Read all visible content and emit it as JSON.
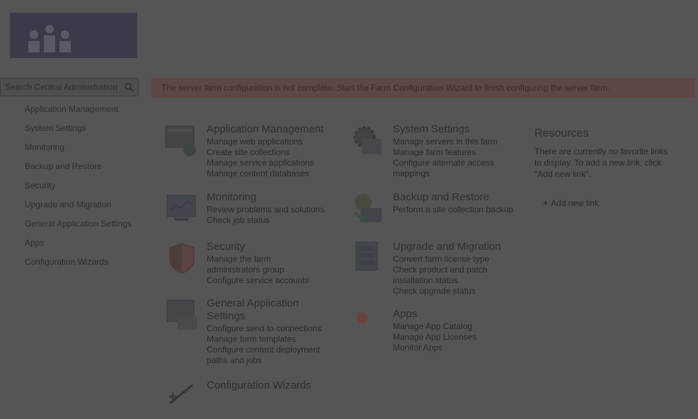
{
  "search": {
    "placeholder": "Search Central Administration"
  },
  "banner": {
    "text": "The server farm configuration is not complete. Start the Farm Configuration Wizard to finish configuring the server farm."
  },
  "leftnav": {
    "items": [
      "Application Management",
      "System Settings",
      "Monitoring",
      "Backup and Restore",
      "Security",
      "Upgrade and Migration",
      "General Application Settings",
      "Apps",
      "Configuration Wizards"
    ]
  },
  "categories": {
    "app_mgmt": {
      "title": "Application Management",
      "links": [
        "Manage web applications",
        "Create site collections",
        "Manage service applications",
        "Manage content databases"
      ]
    },
    "system": {
      "title": "System Settings",
      "links": [
        "Manage servers in this farm",
        "Manage farm features",
        "Configure alternate access mappings"
      ]
    },
    "monitoring": {
      "title": "Monitoring",
      "links": [
        "Review problems and solutions",
        "Check job status"
      ]
    },
    "backup": {
      "title": "Backup and Restore",
      "links": [
        "Perform a site collection backup"
      ]
    },
    "security": {
      "title": "Security",
      "links": [
        "Manage the farm administrators group",
        "Configure service accounts"
      ]
    },
    "upgrade": {
      "title": "Upgrade and Migration",
      "links": [
        "Convert farm license type",
        "Check product and patch installation status",
        "Check upgrade status"
      ]
    },
    "general": {
      "title": "General Application Settings",
      "links": [
        "Configure send to connections",
        "Manage form templates",
        "Configure content deployment paths and jobs"
      ]
    },
    "apps": {
      "title": "Apps",
      "links": [
        "Manage App Catalog",
        "Manage App Licenses",
        "Monitor Apps"
      ]
    },
    "wizards": {
      "title": "Configuration Wizards",
      "links": []
    }
  },
  "resources": {
    "title": "Resources",
    "message": "There are currently no favorite links to display. To add a new link, click \"Add new link\".",
    "add_link": "Add new link"
  },
  "colors": {
    "background": "#555555",
    "banner": "#5e4644",
    "logo": "#3a3a4a"
  }
}
